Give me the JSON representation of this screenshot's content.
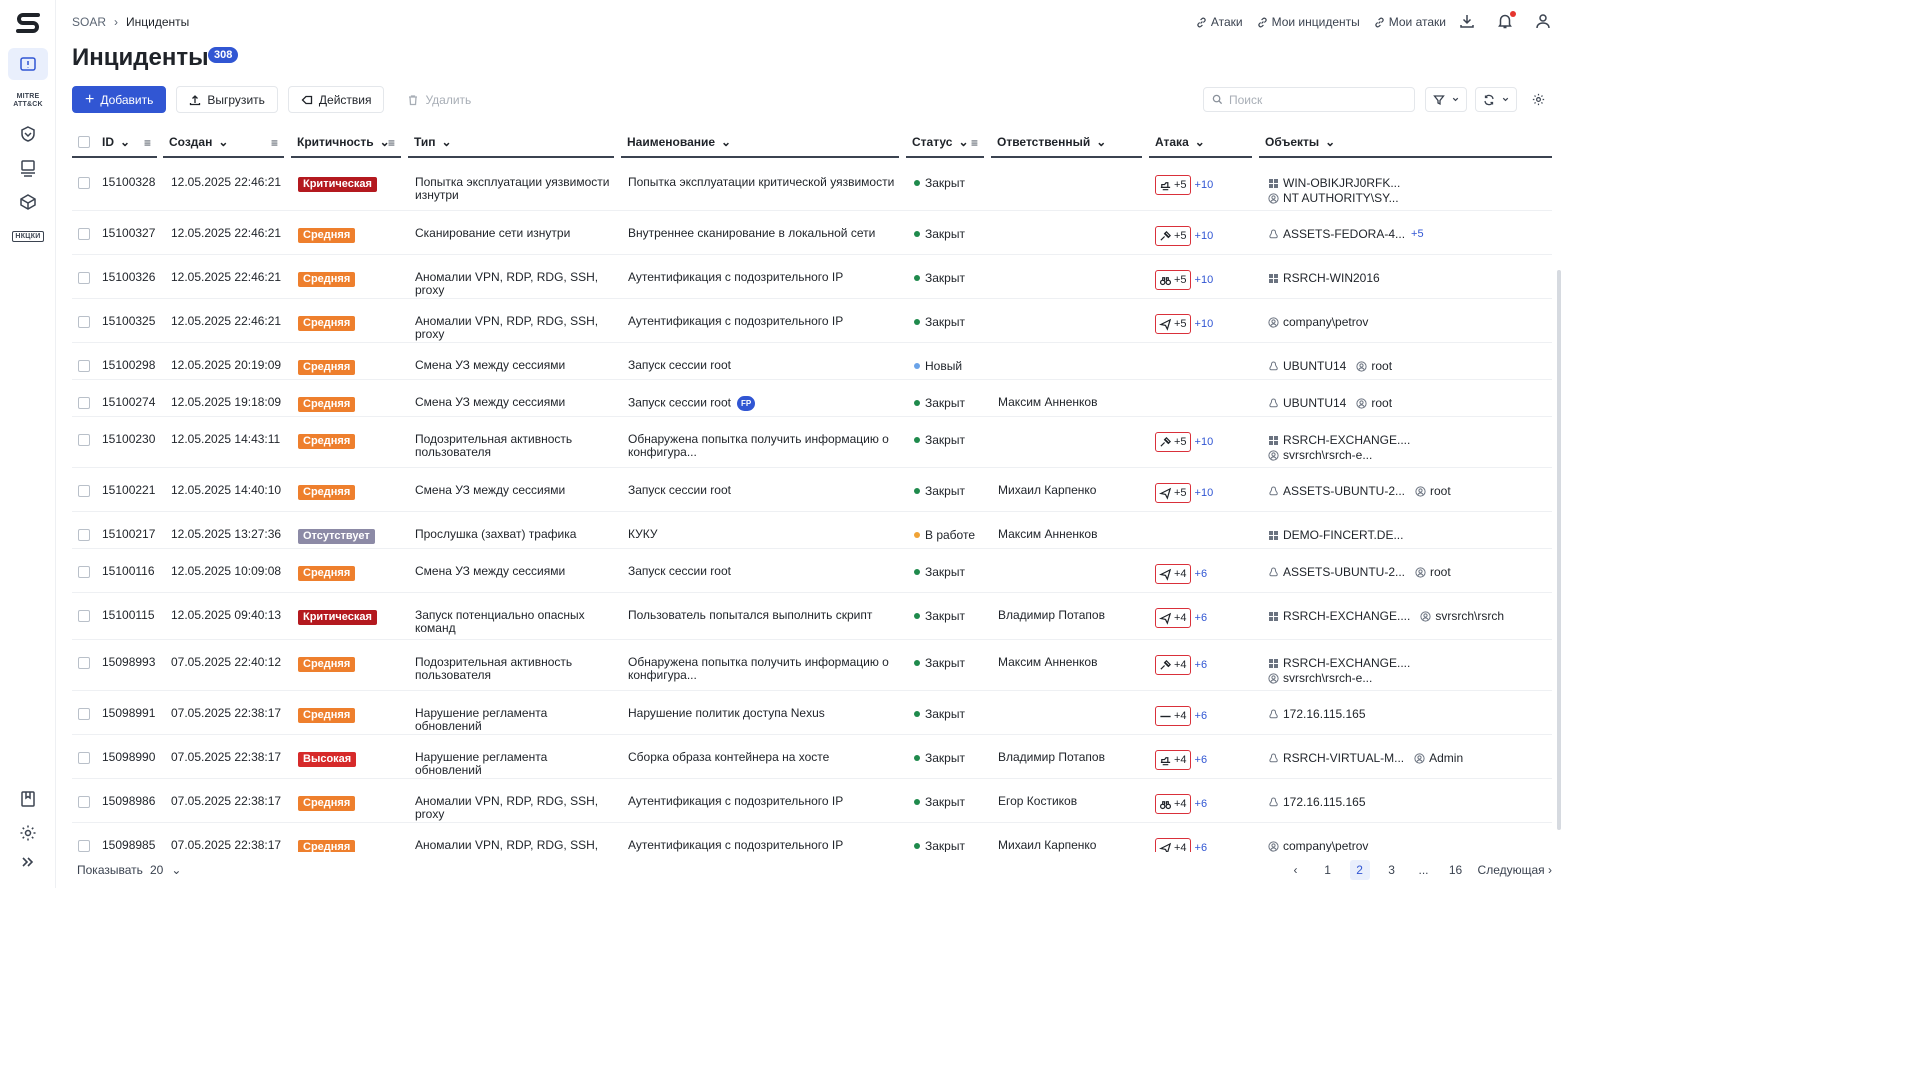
{
  "breadcrumbs": [
    "SOAR",
    "Инциденты"
  ],
  "top_links": [
    "Атаки",
    "Мои инциденты",
    "Мои атаки"
  ],
  "title": "Инциденты",
  "count": "308",
  "toolbar": {
    "add": "Добавить",
    "export": "Выгрузить",
    "actions": "Действия",
    "delete": "Удалить"
  },
  "search_placeholder": "Поиск",
  "columns": {
    "id": "ID",
    "created": "Создан",
    "severity": "Критичность",
    "type": "Тип",
    "name": "Наименование",
    "status": "Статус",
    "assignee": "Ответственный",
    "attack": "Атака",
    "objects": "Объекты"
  },
  "rows": [
    {
      "id": "15100328",
      "created": "12.05.2025 22:46:21",
      "sev": "Критическая",
      "sevc": "crit",
      "type1": "Попытка эксплуатации уязвимости",
      "type2": "изнутри",
      "name1": "Попытка эксплуатации критической уязвимости",
      "name2": "",
      "status": "Закрыт",
      "sc": "#1f8a4c",
      "assignee": "",
      "atk_icon": "hand",
      "atk": "+5",
      "more": "+10",
      "objs": [
        {
          "i": "win",
          "t": "WIN-OBIKJRJ0RFK..."
        },
        {
          "i": "user",
          "t": "NT AUTHORITY\\SY..."
        }
      ],
      "h": 51
    },
    {
      "id": "15100327",
      "created": "12.05.2025 22:46:21",
      "sev": "Средняя",
      "sevc": "mid",
      "type1": "Сканирование сети изнутри",
      "type2": "",
      "name1": "Внутреннее сканирование в локальной сети",
      "name2": "",
      "status": "Закрыт",
      "sc": "#1f8a4c",
      "assignee": "",
      "atk_icon": "scope",
      "atk": "+5",
      "more": "+10",
      "objs": [
        {
          "i": "linux",
          "t": "ASSETS-FEDORA-4...",
          "x": "+5"
        }
      ],
      "h": 44
    },
    {
      "id": "15100326",
      "created": "12.05.2025 22:46:21",
      "sev": "Средняя",
      "sevc": "mid",
      "type1": "Аномалии VPN, RDP, RDG, SSH, proxy",
      "type2": "",
      "name1": "Аутентификация с подозрительного IP",
      "name2": "",
      "status": "Закрыт",
      "sc": "#1f8a4c",
      "assignee": "",
      "atk_icon": "bino",
      "atk": "+5",
      "more": "+10",
      "objs": [
        {
          "i": "win",
          "t": "RSRCH-WIN2016"
        }
      ],
      "h": 44
    },
    {
      "id": "15100325",
      "created": "12.05.2025 22:46:21",
      "sev": "Средняя",
      "sevc": "mid",
      "type1": "Аномалии VPN, RDP, RDG, SSH, proxy",
      "type2": "",
      "name1": "Аутентификация с подозрительного IP",
      "name2": "",
      "status": "Закрыт",
      "sc": "#1f8a4c",
      "assignee": "",
      "atk_icon": "send",
      "atk": "+5",
      "more": "+10",
      "objs": [
        {
          "i": "user",
          "t": "company\\petrov"
        }
      ],
      "h": 44
    },
    {
      "id": "15100298",
      "created": "12.05.2025 20:19:09",
      "sev": "Средняя",
      "sevc": "mid",
      "type1": "Смена УЗ между сессиями",
      "type2": "",
      "name1": "Запуск сессии root",
      "name2": "",
      "status": "Новый",
      "sc": "#6aa3e8",
      "assignee": "",
      "atk_icon": "",
      "atk": "",
      "more": "",
      "objs": [
        {
          "i": "linux",
          "t": "UBUNTU14",
          "u": "root"
        }
      ],
      "h": 37
    },
    {
      "id": "15100274",
      "created": "12.05.2025 19:18:09",
      "sev": "Средняя",
      "sevc": "mid",
      "type1": "Смена УЗ между сессиями",
      "type2": "",
      "name1": "Запуск сессии root",
      "fp": "FP",
      "name2": "",
      "status": "Закрыт",
      "sc": "#1f8a4c",
      "assignee": "Максим Анненков",
      "atk_icon": "",
      "atk": "",
      "more": "",
      "objs": [
        {
          "i": "linux",
          "t": "UBUNTU14",
          "u": "root"
        }
      ],
      "h": 37
    },
    {
      "id": "15100230",
      "created": "12.05.2025 14:43:11",
      "sev": "Средняя",
      "sevc": "mid",
      "type1": "Подозрительная активность",
      "type2": "пользователя",
      "name1": "Обнаружена попытка получить информацию о",
      "name2": "конфигура...",
      "status": "Закрыт",
      "sc": "#1f8a4c",
      "assignee": "",
      "atk_icon": "scope",
      "atk": "+5",
      "more": "+10",
      "objs": [
        {
          "i": "win",
          "t": "RSRCH-EXCHANGE...."
        },
        {
          "i": "user",
          "t": "svrsrch\\rsrch-e..."
        }
      ],
      "h": 51
    },
    {
      "id": "15100221",
      "created": "12.05.2025 14:40:10",
      "sev": "Средняя",
      "sevc": "mid",
      "type1": "Смена УЗ между сессиями",
      "type2": "",
      "name1": "Запуск сессии root",
      "name2": "",
      "status": "Закрыт",
      "sc": "#1f8a4c",
      "assignee": "Михаил Карпенко",
      "atk_icon": "send",
      "atk": "+5",
      "more": "+10",
      "objs": [
        {
          "i": "linux",
          "t": "ASSETS-UBUNTU-2...",
          "u": "root"
        }
      ],
      "h": 44
    },
    {
      "id": "15100217",
      "created": "12.05.2025 13:27:36",
      "sev": "Отсутствует",
      "sevc": "none",
      "type1": "Прослушка (захват) трафика",
      "type2": "",
      "name1": "КУКУ",
      "name2": "",
      "status": "В работе",
      "sc": "#f0a336",
      "assignee": "Максим Анненков",
      "atk_icon": "",
      "atk": "",
      "more": "",
      "objs": [
        {
          "i": "win",
          "t": "DEMO-FINCERT.DE..."
        }
      ],
      "h": 37
    },
    {
      "id": "15100116",
      "created": "12.05.2025 10:09:08",
      "sev": "Средняя",
      "sevc": "mid",
      "type1": "Смена УЗ между сессиями",
      "type2": "",
      "name1": "Запуск сессии root",
      "name2": "",
      "status": "Закрыт",
      "sc": "#1f8a4c",
      "assignee": "",
      "atk_icon": "send",
      "atk": "+4",
      "more": "+6",
      "objs": [
        {
          "i": "linux",
          "t": "ASSETS-UBUNTU-2...",
          "u": "root"
        }
      ],
      "h": 44
    },
    {
      "id": "15100115",
      "created": "12.05.2025 09:40:13",
      "sev": "Критическая",
      "sevc": "crit",
      "type1": "Запуск потенциально опасных",
      "type2": "команд",
      "name1": "Пользователь попытался выполнить скрипт",
      "name2": "",
      "status": "Закрыт",
      "sc": "#1f8a4c",
      "assignee": "Владимир Потапов",
      "atk_icon": "send",
      "atk": "+4",
      "more": "+6",
      "objs": [
        {
          "i": "win",
          "t": "RSRCH-EXCHANGE....",
          "u": "svrsrch\\rsrch"
        }
      ],
      "h": 47
    },
    {
      "id": "15098993",
      "created": "07.05.2025 22:40:12",
      "sev": "Средняя",
      "sevc": "mid",
      "type1": "Подозрительная активность",
      "type2": "пользователя",
      "name1": "Обнаружена попытка получить информацию о",
      "name2": "конфигура...",
      "status": "Закрыт",
      "sc": "#1f8a4c",
      "assignee": "Максим Анненков",
      "atk_icon": "scope",
      "atk": "+4",
      "more": "+6",
      "objs": [
        {
          "i": "win",
          "t": "RSRCH-EXCHANGE...."
        },
        {
          "i": "user",
          "t": "svrsrch\\rsrch-e..."
        }
      ],
      "h": 51
    },
    {
      "id": "15098991",
      "created": "07.05.2025 22:38:17",
      "sev": "Средняя",
      "sevc": "mid",
      "type1": "Нарушение регламента обновлений",
      "type2": "",
      "name1": "Нарушение политик доступа Nexus",
      "name2": "",
      "status": "Закрыт",
      "sc": "#1f8a4c",
      "assignee": "",
      "atk_icon": "line",
      "atk": "+4",
      "more": "+6",
      "objs": [
        {
          "i": "linux",
          "t": "172.16.115.165"
        }
      ],
      "h": 44
    },
    {
      "id": "15098990",
      "created": "07.05.2025 22:38:17",
      "sev": "Высокая",
      "sevc": "high",
      "type1": "Нарушение регламента обновлений",
      "type2": "",
      "name1": "Сборка образа контейнера на хосте",
      "name2": "",
      "status": "Закрыт",
      "sc": "#1f8a4c",
      "assignee": "Владимир Потапов",
      "atk_icon": "hand",
      "atk": "+4",
      "more": "+6",
      "objs": [
        {
          "i": "linux",
          "t": "RSRCH-VIRTUAL-M...",
          "u": "Admin"
        }
      ],
      "h": 44
    },
    {
      "id": "15098986",
      "created": "07.05.2025 22:38:17",
      "sev": "Средняя",
      "sevc": "mid",
      "type1": "Аномалии VPN, RDP, RDG, SSH, proxy",
      "type2": "",
      "name1": "Аутентификация с подозрительного IP",
      "name2": "",
      "status": "Закрыт",
      "sc": "#1f8a4c",
      "assignee": "Егор Костиков",
      "atk_icon": "bino",
      "atk": "+4",
      "more": "+6",
      "objs": [
        {
          "i": "linux",
          "t": "172.16.115.165"
        }
      ],
      "h": 44
    },
    {
      "id": "15098985",
      "created": "07.05.2025 22:38:17",
      "sev": "Средняя",
      "sevc": "mid",
      "type1": "Аномалии VPN, RDP, RDG, SSH, proxy",
      "type2": "",
      "name1": "Аутентификация с подозрительного IP",
      "name2": "",
      "status": "Закрыт",
      "sc": "#1f8a4c",
      "assignee": "Михаил Карпенко",
      "atk_icon": "send",
      "atk": "+4",
      "more": "+6",
      "objs": [
        {
          "i": "user",
          "t": "company\\petrov"
        }
      ],
      "h": 44
    }
  ],
  "footer": {
    "show_label": "Показывать",
    "page_size": "20",
    "pages": [
      "1",
      "2",
      "3",
      "...",
      "16"
    ],
    "current_page": "2",
    "next": "Следующая"
  }
}
